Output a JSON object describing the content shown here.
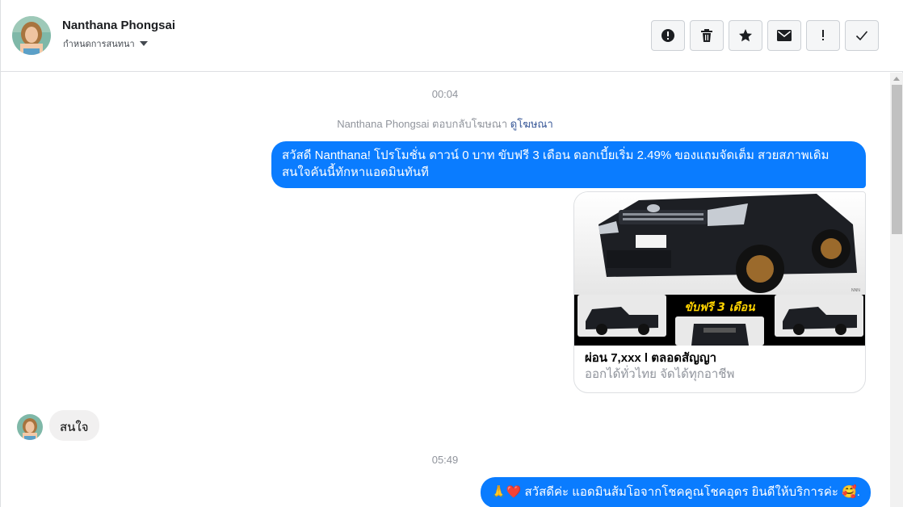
{
  "header": {
    "contact_name": "Nanthana Phongsai",
    "subtitle": "กำหนดการสนทนา",
    "actions": [
      {
        "name": "report-spam-button",
        "icon": "alert-circle-icon",
        "label": "!"
      },
      {
        "name": "delete-button",
        "icon": "trash-icon"
      },
      {
        "name": "star-button",
        "icon": "star-icon"
      },
      {
        "name": "mark-unread-button",
        "icon": "envelope-icon"
      },
      {
        "name": "important-button",
        "icon": "exclamation-icon",
        "label": "!"
      },
      {
        "name": "mark-done-button",
        "icon": "checkmark-icon",
        "label": "✓"
      }
    ]
  },
  "conversation": {
    "timestamp_1": "00:04",
    "system_note": {
      "text": "Nanthana Phongsai ตอบกลับโฆษณา",
      "link": "ดูโฆษณา"
    },
    "message_1": "สวัสดี Nanthana! โปรโมชั่น ดาวน์ 0 บาท ขับฟรี 3 เดือน ดอกเบี้ยเริ่ม 2.49% ของแถมจัดเต็ม สวยสภาพเดิม สนใจคันนี้ทักหาแอดมินทันที",
    "ad_card": {
      "banner_text": "ขับฟรี 3 เดือน",
      "title": "ผ่อน 7,xxx l ตลอดสัญญา",
      "subtitle": "ออกได้ทั่วไทย จัดได้ทุกอาชีพ"
    },
    "reply_1": "สนใจ",
    "timestamp_2": "05:49",
    "message_2": "🙏❤️ สวัสดีค่ะ แอดมินส้มโอจากโชคคูณโชคอุดร ยินดีให้บริการค่ะ 🥰."
  },
  "colors": {
    "outgoing_bubble": "#0a7cff",
    "incoming_bubble": "#f1f0f0",
    "link": "#385898",
    "muted_text": "#90949c"
  }
}
